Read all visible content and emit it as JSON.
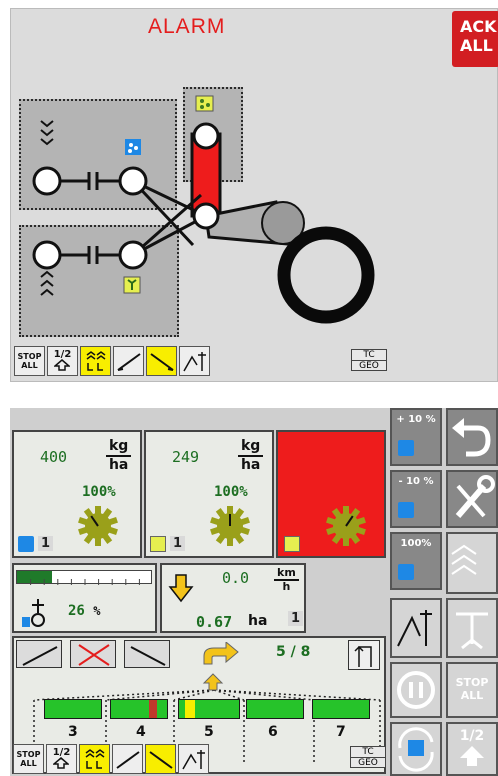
{
  "alarm": {
    "title": "ALARM",
    "ack_label_line1": "ACK",
    "ack_label_line2": "ALL"
  },
  "toolbar": {
    "stop_all_line1": "STOP",
    "stop_all_line2": "ALL",
    "half_label": "1/2",
    "tc_label": "TC",
    "geo_label": "GEO"
  },
  "rates": {
    "left": {
      "value": "400",
      "unit_top": "kg",
      "unit_bottom": "ha",
      "percent": "100%",
      "section": "1"
    },
    "right": {
      "value": "249",
      "unit_top": "kg",
      "unit_bottom": "ha",
      "percent": "100%",
      "section": "1"
    }
  },
  "hopper": {
    "percent": "26",
    "unit": "%"
  },
  "speed": {
    "value": "0.0",
    "unit_top": "km",
    "unit_bottom": "h",
    "area": "0.67",
    "area_unit": "ha",
    "counter": "1"
  },
  "sections": {
    "count": "5 / 8",
    "labels": [
      "3",
      "4",
      "5",
      "6",
      "7"
    ]
  },
  "side_panel": {
    "plus_label": "+ 10 %",
    "minus_label": "- 10 %",
    "hundred_label": "100%",
    "stop_all_line1": "STOP",
    "stop_all_line2": "ALL",
    "half_label": "1/2"
  },
  "colors": {
    "alarm_red": "#e41d1d",
    "active_green": "#26c32a",
    "highlight_yellow": "#f8ee00",
    "fault_red": "#ee1c1c",
    "gauge_olive": "#9aa01a",
    "value_green": "#1d6e22",
    "water_blue": "#1e88e5"
  }
}
